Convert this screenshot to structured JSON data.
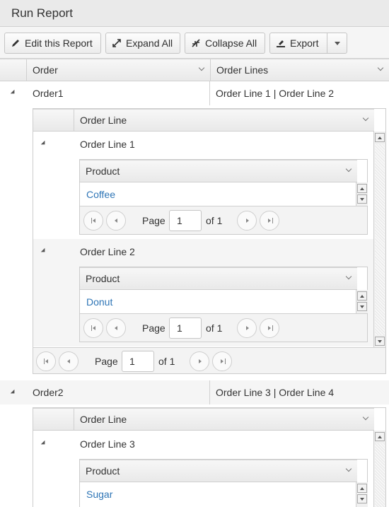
{
  "window": {
    "title": "Run Report"
  },
  "toolbar": {
    "edit_label": "Edit this Report",
    "expand_label": "Expand All",
    "collapse_label": "Collapse All",
    "export_label": "Export"
  },
  "grid": {
    "columns": [
      "Order",
      "Order Lines"
    ],
    "detail_column": "Order Line",
    "product_column": "Product"
  },
  "orders": [
    {
      "name": "Order1",
      "lines": "Order Line 1 | Order Line 2",
      "order_lines": [
        {
          "name": "Order Line 1",
          "product": "Coffee",
          "page": "1",
          "of": "of 1"
        },
        {
          "name": "Order Line 2",
          "product": "Donut",
          "page": "1",
          "of": "of 1"
        }
      ],
      "page": "1",
      "of": "of 1"
    },
    {
      "name": "Order2",
      "lines": "Order Line 3 | Order Line 4",
      "order_lines": [
        {
          "name": "Order Line 3",
          "product": "Sugar"
        }
      ]
    }
  ],
  "pager": {
    "page_label": "Page"
  },
  "colors": {
    "link": "#2e75b6",
    "header_bg": "#ececec"
  }
}
